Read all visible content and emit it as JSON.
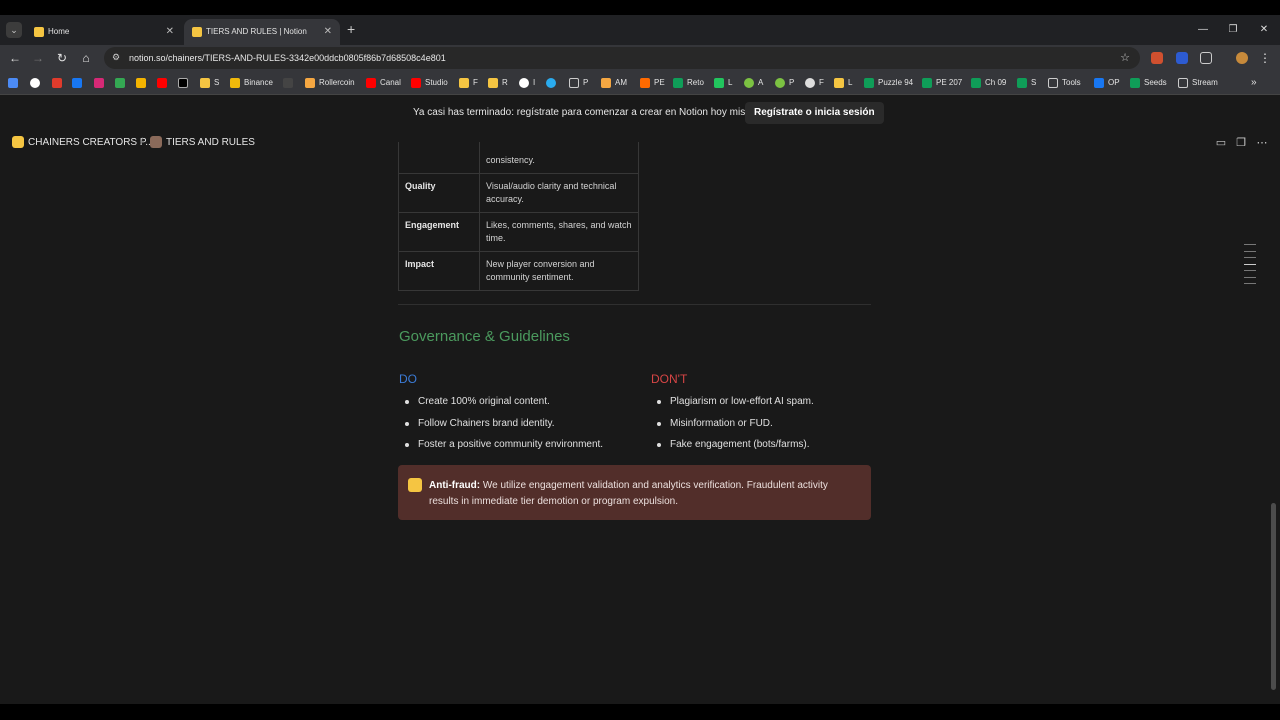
{
  "browser": {
    "tabs": [
      {
        "title": "Home",
        "close": "✕"
      },
      {
        "title": "TIERS AND RULES | Notion",
        "close": "✕"
      }
    ],
    "new_tab": "+",
    "url": "notion.so/chainers/TIERS-AND-RULES-3342e00ddcb0805f86b7d68508c4e801",
    "bookmarks": [
      "S",
      "Binance",
      "Rollercoin",
      "Canal",
      "Studio",
      "F",
      "R",
      "I",
      "P",
      "AM",
      "PE",
      "Reto",
      "L",
      "A",
      "P",
      "F",
      "L",
      "Puzzle 94",
      "PE 207",
      "Ch 09",
      "S",
      "Tools",
      "OP",
      "Seeds",
      "Stream"
    ]
  },
  "banner": {
    "message": "Ya casi has terminado: regístrate para comenzar a crear en Notion hoy mismo.",
    "button": "Regístrate o inicia sesión"
  },
  "breadcrumb": {
    "parent": "CHAINERS CREATORS P...",
    "separator": "/",
    "current": "TIERS AND RULES"
  },
  "criteria_table": {
    "rows": [
      {
        "key": "",
        "value": "consistency."
      },
      {
        "key": "Quality",
        "value": "Visual/audio clarity and technical accuracy."
      },
      {
        "key": "Engagement",
        "value": "Likes, comments, shares, and watch time."
      },
      {
        "key": "Impact",
        "value": "New player conversion and community sentiment."
      }
    ]
  },
  "governance": {
    "heading": "Governance & Guidelines",
    "do_title": "DO",
    "do_items": [
      "Create 100% original content.",
      "Follow Chainers brand identity.",
      "Foster a positive community environment."
    ],
    "dont_title": "DON'T",
    "dont_items": [
      "Plagiarism or low-effort AI spam.",
      "Misinformation or FUD.",
      "Fake engagement (bots/farms)."
    ]
  },
  "callout": {
    "label": "Anti-fraud:",
    "text": " We utilize engagement validation and analytics verification. Fraudulent activity results in immediate tier demotion or program expulsion."
  },
  "colors": {
    "heading_green": "#4b9a5e",
    "do_blue": "#3b7bd6",
    "dont_red": "#d64545",
    "callout_bg": "#522e2a"
  }
}
